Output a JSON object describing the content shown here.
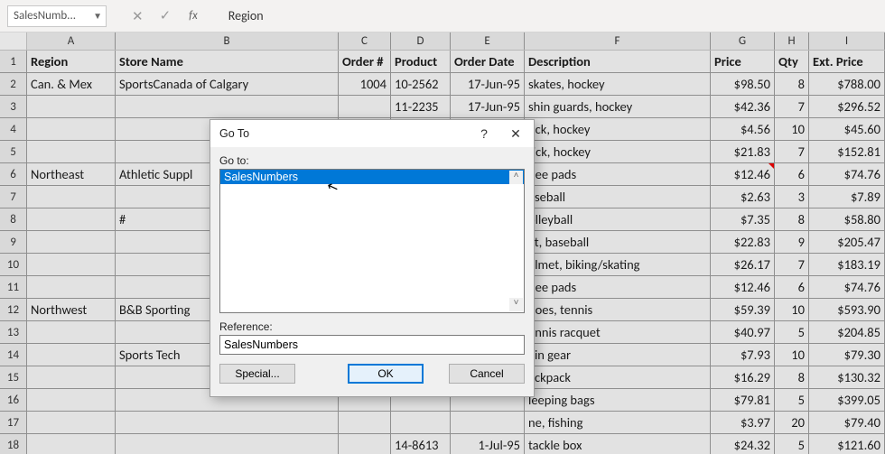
{
  "namebox": "SalesNumb...",
  "formulabar": {
    "fx": "fx",
    "value": "Region"
  },
  "columns": [
    "A",
    "B",
    "C",
    "D",
    "E",
    "F",
    "G",
    "H",
    "I"
  ],
  "header": {
    "A": "Region",
    "B": "Store Name",
    "C": "Order #",
    "D": "Product",
    "E": "Order Date",
    "F": "Description",
    "G": "Price",
    "H": "Qty",
    "I": "Ext. Price"
  },
  "rows": [
    {
      "n": 2,
      "A": "Can. & Mex",
      "B": "SportsCanada of Calgary",
      "C": "1004",
      "D": "10-2562",
      "E": "17-Jun-95",
      "F": "skates, hockey",
      "G": "$98.50",
      "H": "8",
      "I": "$788.00"
    },
    {
      "n": 3,
      "A": "",
      "B": "",
      "C": "",
      "D": "11-2235",
      "E": "17-Jun-95",
      "F": "shin guards, hockey",
      "G": "$42.36",
      "H": "7",
      "I": "$296.52"
    },
    {
      "n": 4,
      "A": "",
      "B": "",
      "C": "",
      "D": "",
      "E": "",
      "F": "uck, hockey",
      "G": "$4.56",
      "H": "10",
      "I": "$45.60"
    },
    {
      "n": 5,
      "A": "",
      "B": "",
      "C": "",
      "D": "",
      "E": "",
      "F": "tick, hockey",
      "G": "$21.83",
      "H": "7",
      "I": "$152.81"
    },
    {
      "n": 6,
      "A": "Northeast",
      "B": "Athletic Suppl",
      "C": "",
      "D": "",
      "E": "",
      "F": "nee pads",
      "G": "$12.46",
      "H": "6",
      "I": "$74.76",
      "comment": true
    },
    {
      "n": 7,
      "A": "",
      "B": "",
      "C": "",
      "D": "",
      "E": "",
      "F": "aseball",
      "G": "$2.63",
      "H": "3",
      "I": "$7.89"
    },
    {
      "n": 8,
      "A": "",
      "B": "#",
      "C": "",
      "D": "",
      "E": "",
      "F": "olleyball",
      "G": "$7.35",
      "H": "8",
      "I": "$58.80"
    },
    {
      "n": 9,
      "A": "",
      "B": "",
      "C": "",
      "D": "",
      "E": "",
      "F": "at, baseball",
      "G": "$22.83",
      "H": "9",
      "I": "$205.47"
    },
    {
      "n": 10,
      "A": "",
      "B": "",
      "C": "",
      "D": "",
      "E": "",
      "F": "elmet, biking/skating",
      "G": "$26.17",
      "H": "7",
      "I": "$183.19"
    },
    {
      "n": 11,
      "A": "",
      "B": "",
      "C": "",
      "D": "",
      "E": "",
      "F": "nee pads",
      "G": "$12.46",
      "H": "6",
      "I": "$74.76"
    },
    {
      "n": 12,
      "A": "Northwest",
      "B": "B&B Sporting",
      "C": "",
      "D": "",
      "E": "",
      "F": "hoes, tennis",
      "G": "$59.39",
      "H": "10",
      "I": "$593.90"
    },
    {
      "n": 13,
      "A": "",
      "B": "",
      "C": "",
      "D": "",
      "E": "",
      "F": "ennis racquet",
      "G": "$40.97",
      "H": "5",
      "I": "$204.85"
    },
    {
      "n": 14,
      "A": "",
      "B": "Sports Tech",
      "C": "",
      "D": "",
      "E": "",
      "F": "ain gear",
      "G": "$7.93",
      "H": "10",
      "I": "$79.30"
    },
    {
      "n": 15,
      "A": "",
      "B": "",
      "C": "",
      "D": "",
      "E": "",
      "F": "ackpack",
      "G": "$16.29",
      "H": "8",
      "I": "$130.32"
    },
    {
      "n": 16,
      "A": "",
      "B": "",
      "C": "",
      "D": "",
      "E": "",
      "F": "leeping bags",
      "G": "$79.81",
      "H": "5",
      "I": "$399.05"
    },
    {
      "n": 17,
      "A": "",
      "B": "",
      "C": "",
      "D": "",
      "E": "",
      "F": "ne, fishing",
      "G": "$3.97",
      "H": "20",
      "I": "$79.40"
    },
    {
      "n": 18,
      "A": "",
      "B": "",
      "C": "",
      "D": "14-8613",
      "E": "1-Jul-95",
      "F": "tackle box",
      "G": "$24.32",
      "H": "5",
      "I": "$121.60"
    }
  ],
  "dialog": {
    "title": "Go To",
    "goto_label": "Go to:",
    "list_selected": "SalesNumbers",
    "reference_label": "Reference:",
    "reference_value": "SalesNumbers",
    "buttons": {
      "special": "Special...",
      "ok": "OK",
      "cancel": "Cancel"
    }
  }
}
